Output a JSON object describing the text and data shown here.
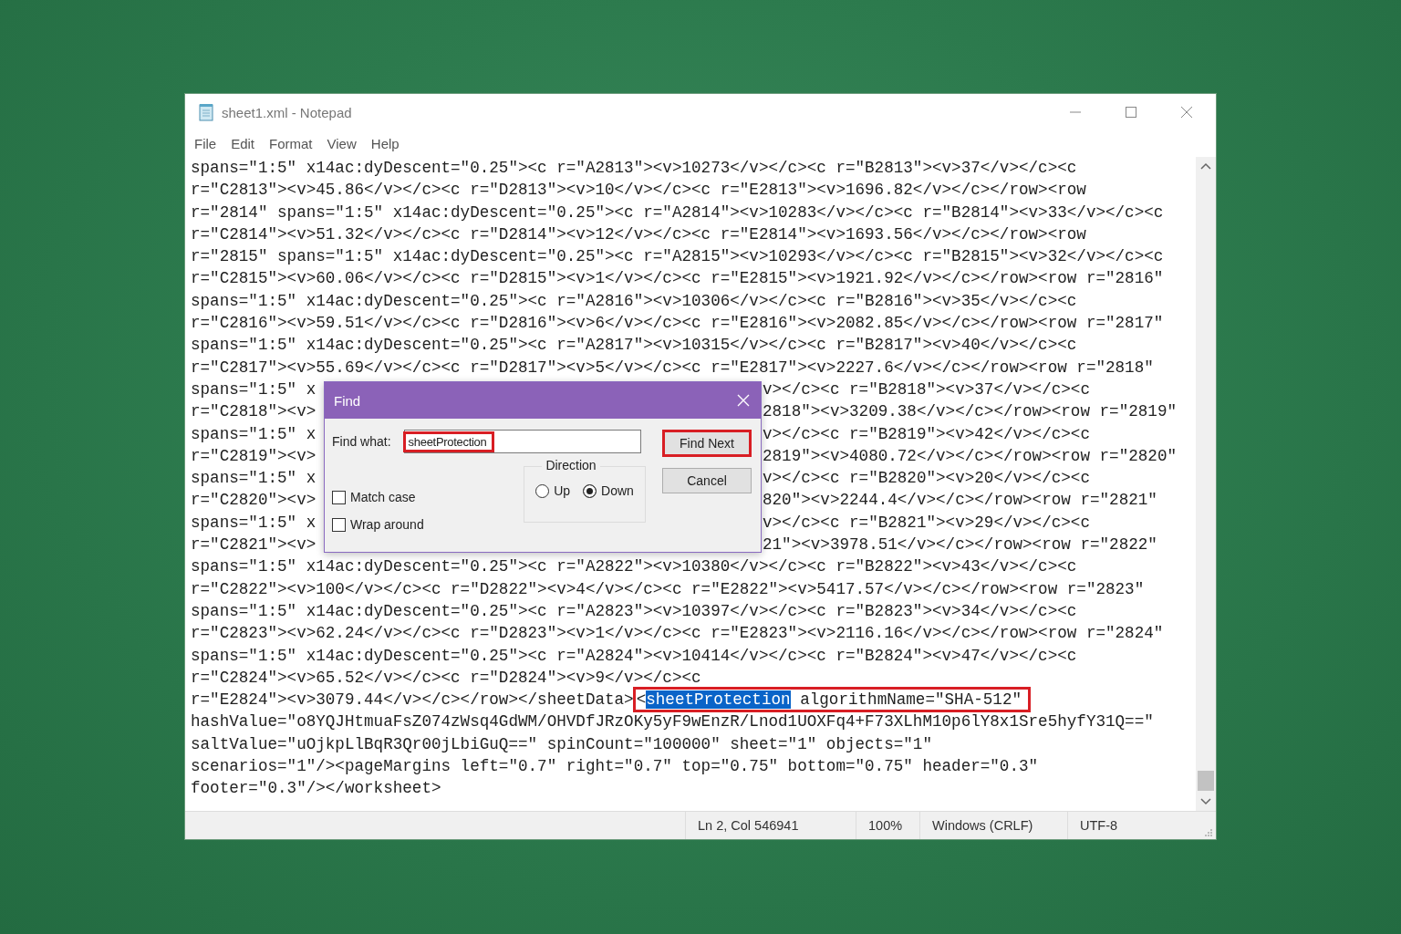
{
  "window": {
    "title": "sheet1.xml - Notepad"
  },
  "menu": [
    "File",
    "Edit",
    "Format",
    "View",
    "Help"
  ],
  "editor": {
    "lines": [
      {
        "kind": "plain",
        "text": "spans=\"1:5\" x14ac:dyDescent=\"0.25\"><c r=\"A2813\"><v>10273</v></c><c r=\"B2813\"><v>37</v></c><c"
      },
      {
        "kind": "plain",
        "text": "r=\"C2813\"><v>45.86</v></c><c r=\"D2813\"><v>10</v></c><c r=\"E2813\"><v>1696.82</v></c></row><row"
      },
      {
        "kind": "plain",
        "text": "r=\"2814\" spans=\"1:5\" x14ac:dyDescent=\"0.25\"><c r=\"A2814\"><v>10283</v></c><c r=\"B2814\"><v>33</v></c><c"
      },
      {
        "kind": "plain",
        "text": "r=\"C2814\"><v>51.32</v></c><c r=\"D2814\"><v>12</v></c><c r=\"E2814\"><v>1693.56</v></c></row><row"
      },
      {
        "kind": "plain",
        "text": "r=\"2815\" spans=\"1:5\" x14ac:dyDescent=\"0.25\"><c r=\"A2815\"><v>10293</v></c><c r=\"B2815\"><v>32</v></c><c"
      },
      {
        "kind": "plain",
        "text": "r=\"C2815\"><v>60.06</v></c><c r=\"D2815\"><v>1</v></c><c r=\"E2815\"><v>1921.92</v></c></row><row r=\"2816\""
      },
      {
        "kind": "plain",
        "text": "spans=\"1:5\" x14ac:dyDescent=\"0.25\"><c r=\"A2816\"><v>10306</v></c><c r=\"B2816\"><v>35</v></c><c"
      },
      {
        "kind": "plain",
        "text": "r=\"C2816\"><v>59.51</v></c><c r=\"D2816\"><v>6</v></c><c r=\"E2816\"><v>2082.85</v></c></row><row r=\"2817\""
      },
      {
        "kind": "plain",
        "text": "spans=\"1:5\" x14ac:dyDescent=\"0.25\"><c r=\"A2817\"><v>10315</v></c><c r=\"B2817\"><v>40</v></c><c"
      },
      {
        "kind": "plain",
        "text": "r=\"C2817\"><v>55.69</v></c><c r=\"D2817\"><v>5</v></c><c r=\"E2817\"><v>2227.6</v></c></row><row r=\"2818\""
      },
      {
        "kind": "covered",
        "left": "spans=\"1:5\" x",
        "right": "v></c><c r=\"B2818\"><v>37</v></c><c"
      },
      {
        "kind": "covered",
        "left": "r=\"C2818\"><v>",
        "right": "2818\"><v>3209.38</v></c></row><row r=\"2819\""
      },
      {
        "kind": "covered",
        "left": "spans=\"1:5\" x",
        "right": "v></c><c r=\"B2819\"><v>42</v></c><c"
      },
      {
        "kind": "covered",
        "left": "r=\"C2819\"><v>",
        "right": "2819\"><v>4080.72</v></c></row><row r=\"2820\""
      },
      {
        "kind": "covered",
        "left": "spans=\"1:5\" x",
        "right": "v></c><c r=\"B2820\"><v>20</v></c><c"
      },
      {
        "kind": "covered",
        "left": "r=\"C2820\"><v>",
        "right": "820\"><v>2244.4</v></c></row><row r=\"2821\""
      },
      {
        "kind": "covered",
        "left": "spans=\"1:5\" x",
        "right": "v></c><c r=\"B2821\"><v>29</v></c><c"
      },
      {
        "kind": "covered",
        "left": "r=\"C2821\"><v>",
        "right": "21\"><v>3978.51</v></c></row><row r=\"2822\""
      },
      {
        "kind": "plain",
        "text": "spans=\"1:5\" x14ac:dyDescent=\"0.25\"><c r=\"A2822\"><v>10380</v></c><c r=\"B2822\"><v>43</v></c><c"
      },
      {
        "kind": "plain",
        "text": "r=\"C2822\"><v>100</v></c><c r=\"D2822\"><v>4</v></c><c r=\"E2822\"><v>5417.57</v></c></row><row r=\"2823\""
      },
      {
        "kind": "plain",
        "text": "spans=\"1:5\" x14ac:dyDescent=\"0.25\"><c r=\"A2823\"><v>10397</v></c><c r=\"B2823\"><v>34</v></c><c"
      },
      {
        "kind": "plain",
        "text": "r=\"C2823\"><v>62.24</v></c><c r=\"D2823\"><v>1</v></c><c r=\"E2823\"><v>2116.16</v></c></row><row r=\"2824\""
      },
      {
        "kind": "plain",
        "text": "spans=\"1:5\" x14ac:dyDescent=\"0.25\"><c r=\"A2824\"><v>10414</v></c><c r=\"B2824\"><v>47</v></c><c"
      },
      {
        "kind": "plain",
        "text": "r=\"C2824\"><v>65.52</v></c><c r=\"D2824\"><v>9</v></c><c"
      },
      {
        "kind": "match",
        "before": "r=\"E2824\"><v>3079.44</v></c></row></sheetData>",
        "prefix": "<",
        "match": "sheetProtection",
        "after": " algorithmName=\"SHA-512\"",
        "annotated": true
      },
      {
        "kind": "plain",
        "text": "hashValue=\"o8YQJHtmuaFsZ074zWsq4GdWM/OHVDfJRzOKy5yF9wEnzR/Lnod1UOXFq4+F73XLhM10p6lY8x1Sre5hyfY31Q==\""
      },
      {
        "kind": "plain",
        "text": "saltValue=\"uOjkpLlBqR3Qr00jLbiGuQ==\" spinCount=\"100000\" sheet=\"1\" objects=\"1\""
      },
      {
        "kind": "plain",
        "text": "scenarios=\"1\"/><pageMargins left=\"0.7\" right=\"0.7\" top=\"0.75\" bottom=\"0.75\" header=\"0.3\""
      },
      {
        "kind": "plain",
        "text": "footer=\"0.3\"/></worksheet>"
      }
    ]
  },
  "find_dialog": {
    "title": "Find",
    "find_what_label": "Find what:",
    "find_what": {
      "value": "sheetProtection",
      "annotated": true
    },
    "buttons": [
      {
        "label": "Find Next",
        "annotated": true
      },
      {
        "label": "Cancel",
        "annotated": false
      }
    ],
    "direction": {
      "label": "Direction",
      "options": [
        {
          "label": "Up",
          "selected": false
        },
        {
          "label": "Down",
          "selected": true
        }
      ]
    },
    "options": [
      {
        "label": "Match case",
        "checked": false
      },
      {
        "label": "Wrap around",
        "checked": false
      }
    ]
  },
  "status_bar": [
    "Ln 2, Col 546941",
    "100%",
    "Windows (CRLF)",
    "UTF-8"
  ]
}
